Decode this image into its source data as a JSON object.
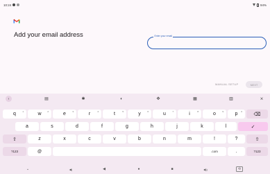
{
  "status": {
    "time": "10:24",
    "battery": "94%"
  },
  "page": {
    "title": "Add your email address"
  },
  "email": {
    "label": "Enter your email",
    "value": ""
  },
  "actions": {
    "manual_setup": "MANUAL SETUP",
    "next": "NEXT"
  },
  "keyboard": {
    "toolbar": {
      "back": "‹",
      "clipboard": "▤",
      "settings": "✱",
      "theme": "◐",
      "move": "✥",
      "layout": "▦",
      "modes": "▥",
      "mic_off": "⨯"
    },
    "row1": [
      {
        "k": "q",
        "s": "1"
      },
      {
        "k": "w",
        "s": "2"
      },
      {
        "k": "e",
        "s": "3"
      },
      {
        "k": "r",
        "s": "4"
      },
      {
        "k": "t",
        "s": "5"
      },
      {
        "k": "y",
        "s": "6"
      },
      {
        "k": "u",
        "s": "7"
      },
      {
        "k": "i",
        "s": "8"
      },
      {
        "k": "o",
        "s": "9"
      },
      {
        "k": "p",
        "s": "0"
      }
    ],
    "backspace": "⌫",
    "row2": [
      "a",
      "s",
      "d",
      "f",
      "g",
      "h",
      "j",
      "k",
      "l"
    ],
    "enter": "✓",
    "shift": "⇧",
    "row3": [
      "z",
      "x",
      "c",
      "v",
      "b",
      "n",
      "m",
      "!",
      "?"
    ],
    "shift_right": "⇧",
    "symbols": "?123",
    "at": "@",
    "dotcom": ".com",
    "period": ".",
    "symbols_right": "?123",
    "nav": {
      "hide": "⌄",
      "vol_down": "◀)",
      "back": "◀",
      "home": "●",
      "recent": "■",
      "vol_up": "◀))",
      "rotate": "⟲"
    }
  }
}
